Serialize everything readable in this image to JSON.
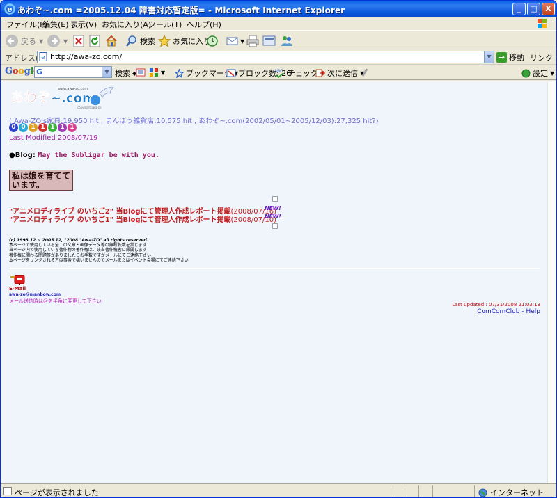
{
  "window": {
    "title": "あわぞ~.com =2005.12.04 障害対応暫定版= - Microsoft Internet Explorer",
    "controls": {
      "minimize": "_",
      "maximize": "□",
      "close": "X"
    }
  },
  "menu": {
    "items": [
      "ファイル(F)",
      "編集(E)",
      "表示(V)",
      "お気に入り(A)",
      "ツール(T)",
      "ヘルプ(H)"
    ]
  },
  "toolbar": {
    "back": "戻る",
    "search": "検索",
    "favorites": "お気に入り"
  },
  "address": {
    "label": "アドレス(D)",
    "url": "http://awa-zo.com/",
    "go": "移動",
    "links": "リンク"
  },
  "google_toolbar": {
    "logo": "Google",
    "search_label": "検索",
    "bookmarks": "ブックマーク",
    "blocked": "ブロック数: 20",
    "check": "チェック",
    "send_to": "次に送信",
    "settings": "設定"
  },
  "page": {
    "visits": "( Awa-ZO's家頁:19,950 hit , まんぼう雑貨店:10,575 hit , あわぞ~.com(2002/05/01~2005/12/03):27,325 hit?)",
    "counter_digits": [
      "0",
      "0",
      "1",
      "1",
      "1",
      "1",
      "1"
    ],
    "counter_colors": [
      "#3040d0",
      "#2aa9d8",
      "#e0a020",
      "#d03030",
      "#40b040",
      "#a040b0",
      "#e04090"
    ],
    "last_modified": "Last Modified 2008/07/19",
    "blog_bullet": "●",
    "blog_label": "Blog:",
    "blog_title": "May the Subligar be with you.",
    "banner_text": "私は娘を育てています。",
    "announcements": [
      {
        "text": "\"アニメロディライブ のいちご2\" 当Blogにて管理人作成レポート掲載",
        "date": "(2008/07/16)",
        "badge": "NEW!"
      },
      {
        "text": "\"アニメロディライブ のいちご1\" 当Blogにて管理人作成レポート掲載",
        "date": "(2008/07/10)",
        "badge": "NEW!"
      }
    ],
    "copyright": "(c) 1998.12 ~ 2005.12, \"2008 \"Awa-ZO\" all rights reserved.",
    "notices": [
      "本ページで使用している全ての文章・画像データ等の無断転載を禁じます",
      "当ページ内で使用している著作物の著作権は、該当著作権者に帰属します",
      "著作権に関わる問題等がありましたらお手数ですがメールにてご連絡下さい",
      "本ページをリンクされる方は事後で構いませんのでメールまたはイベント会場にてご連絡下さい"
    ],
    "mail_label": "E-Mail",
    "mail_address": "awa-zo@manbow.com",
    "mail_note": "メール送信時は＠を半角に変更して下さい",
    "last_updated": "Last updated : 07/31/2008 21:03:13",
    "footer_link": "ComComClub - Help"
  },
  "status": {
    "message": "ページが表示されました",
    "zone": "インターネット"
  }
}
